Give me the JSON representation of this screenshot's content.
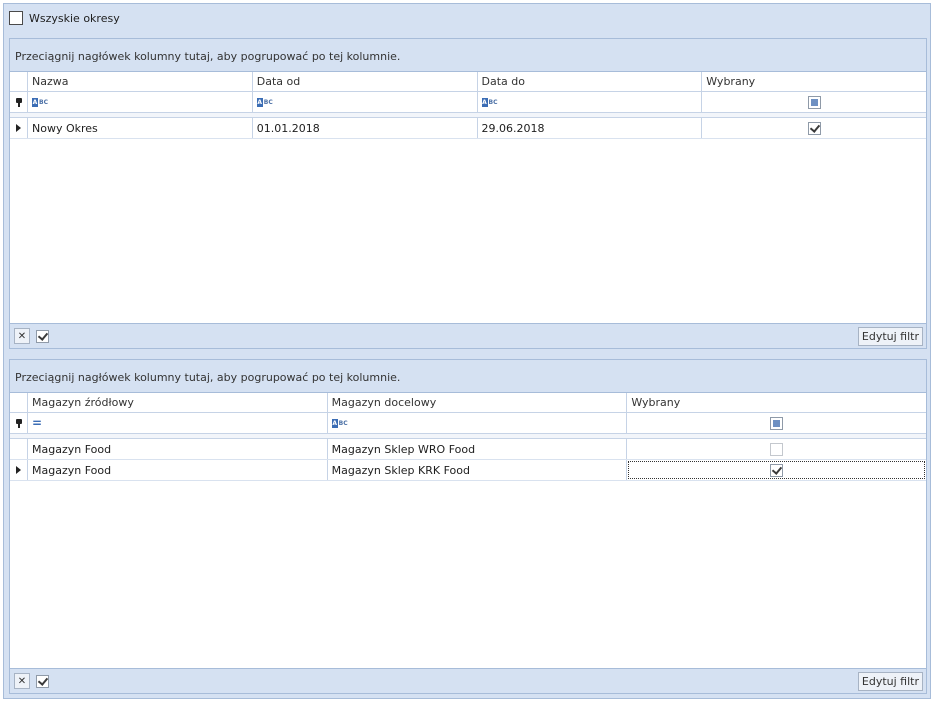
{
  "all_periods": {
    "label": "Wszyskie okresy",
    "checked": false
  },
  "periods_grid": {
    "group_hint": "Przeciągnij nagłówek kolumny tutaj, aby pogrupować po tej kolumnie.",
    "columns": [
      "Nazwa",
      "Data od",
      "Data do",
      "Wybrany"
    ],
    "rows": [
      {
        "nazwa": "Nowy Okres",
        "data_od": "01.01.2018",
        "data_do": "29.06.2018",
        "wybrany": true
      }
    ],
    "footer": {
      "edit_filter": "Edytuj filtr"
    }
  },
  "warehouses_grid": {
    "group_hint": "Przeciągnij nagłówek kolumny tutaj, aby pogrupować po tej kolumnie.",
    "columns": [
      "Magazyn źródłowy",
      "Magazyn docelowy",
      "Wybrany"
    ],
    "rows": [
      {
        "zrodlowy": "Magazyn Food",
        "docelowy": "Magazyn Sklep WRO Food",
        "wybrany": false
      },
      {
        "zrodlowy": "Magazyn Food",
        "docelowy": "Magazyn Sklep KRK Food",
        "wybrany": true
      }
    ],
    "footer": {
      "edit_filter": "Edytuj filtr"
    }
  },
  "icons": {
    "filter_row": "pin-icon",
    "text_filter": "abc-filter-icon",
    "equals_filter": "equals-filter-icon",
    "current_row": "row-indicator-arrow-icon",
    "clear_filter": "close-icon",
    "enable_filter": "checkbox-icon"
  }
}
